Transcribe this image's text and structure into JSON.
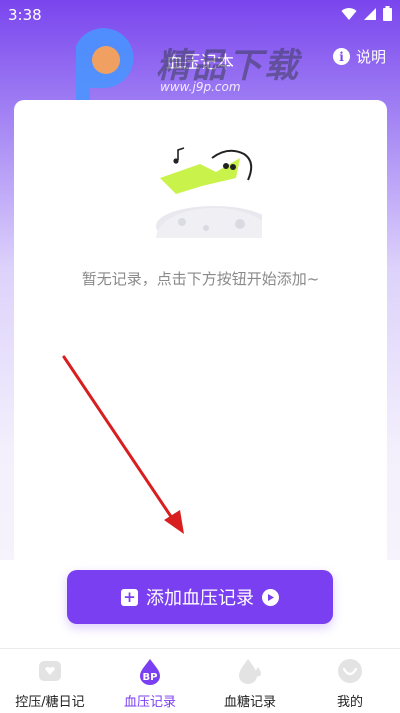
{
  "status_bar": {
    "time": "3:38"
  },
  "header": {
    "title": "血压记本",
    "help_label": "说明"
  },
  "watermark": {
    "text": "精品下载",
    "url": "www.j9p.com"
  },
  "empty_state": {
    "message": "暂无记录，点击下方按钮开始添加~"
  },
  "add_button": {
    "label": "添加血压记录"
  },
  "bottom_nav": {
    "items": [
      {
        "label": "控压/糖日记",
        "icon": "diary-icon",
        "active": false
      },
      {
        "label": "血压记录",
        "icon": "bp-drop-icon",
        "badge": "BP",
        "active": true
      },
      {
        "label": "血糖记录",
        "icon": "glucose-drop-icon",
        "active": false
      },
      {
        "label": "我的",
        "icon": "profile-icon",
        "active": false
      }
    ]
  },
  "colors": {
    "accent": "#7b3ff2",
    "header_top": "#7a45ee",
    "annotation_arrow": "#d81e1e",
    "illustration_green": "#c9f24a"
  }
}
